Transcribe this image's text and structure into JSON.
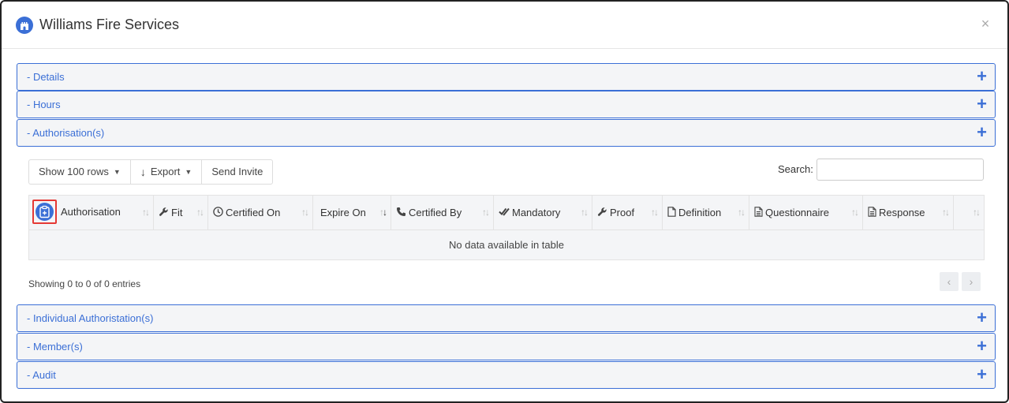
{
  "modal": {
    "title": "Williams Fire Services",
    "brand_icon": "castle-icon",
    "close_symbol": "×"
  },
  "panels": {
    "details": "- Details",
    "hours": "- Hours",
    "authorisations": "- Authorisation(s)",
    "individual": "- Individual Authoristation(s)",
    "members": "- Member(s)",
    "audit": "- Audit",
    "plus": "+"
  },
  "toolbar": {
    "show_rows": "Show 100 rows",
    "export": "Export",
    "send_invite": "Send Invite",
    "search_label": "Search:",
    "search_value": ""
  },
  "table": {
    "columns": [
      {
        "label": "Authorisation",
        "icon": "clipboard-plus-icon"
      },
      {
        "label": "Fit",
        "icon": "wrench-icon"
      },
      {
        "label": "Certified On",
        "icon": "clock-icon"
      },
      {
        "label": "Expire On",
        "icon": ""
      },
      {
        "label": "Certified By",
        "icon": "phone-icon"
      },
      {
        "label": "Mandatory",
        "icon": "double-check-icon"
      },
      {
        "label": "Proof",
        "icon": "wrench-icon"
      },
      {
        "label": "Definition",
        "icon": "file-icon"
      },
      {
        "label": "Questionnaire",
        "icon": "file-text-icon"
      },
      {
        "label": "Response",
        "icon": "file-text-icon"
      },
      {
        "label": "",
        "icon": ""
      }
    ],
    "sort_symbol": "↑↓",
    "empty_message": "No data available in table"
  },
  "footer": {
    "info": "Showing 0 to 0 of 0 entries",
    "prev": "‹",
    "next": "›"
  },
  "colors": {
    "accent": "#3b6fd6",
    "highlight": "#e53935"
  }
}
